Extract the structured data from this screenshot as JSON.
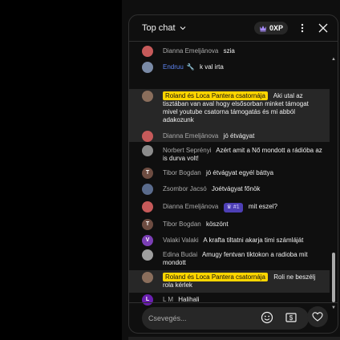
{
  "header": {
    "title": "Top chat",
    "xp": "0XP",
    "icons": {
      "dropdown": "chevron-down-icon",
      "crown": "crown-icon",
      "more": "more-vert-icon",
      "close": "close-icon"
    }
  },
  "colors": {
    "background": "#0f0f0f",
    "highlight": "#272727",
    "owner_badge": "#ffd600",
    "moderator": "#5e84f1",
    "member_badge": "#4d3fb5"
  },
  "messages": [
    {
      "author": "Dianna Emeljānova",
      "text": "szia",
      "avatar_color": "#c65a5a"
    },
    {
      "author": "Endruu",
      "text": "k val irta",
      "role": "moderator",
      "avatar_color": "#7a8aa6"
    },
    {
      "author": "Roland és Loca Pantera csatornája",
      "text": "Aki utal az tisztában van aval hogy elsősorban minket támogat mivel youtube csatorna támogatás és mi abból adakozunk",
      "role": "owner",
      "avatar_color": "#8a6e5c"
    },
    {
      "author": "Dianna Emeljānova",
      "text": "jó étvágyat",
      "avatar_color": "#c65a5a"
    },
    {
      "author": "Norbert Seprényi",
      "text": "Azért amit a Nő mondott a rádióba az is durva volt!",
      "avatar_color": "#8c8c8c"
    },
    {
      "author": "Tibor Bogdan",
      "text": "jó étvágyat egyél báttya",
      "avatar_initial": "T",
      "avatar_color": "#6d4c41"
    },
    {
      "author": "Zsombor Jacsó",
      "text": "Joétvágyat főnök",
      "avatar_color": "#5a6b8c"
    },
    {
      "author": "Dianna Emeljānova",
      "text": "mit eszel?",
      "member_badge": "#1",
      "avatar_color": "#c65a5a"
    },
    {
      "author": "Tibor Bogdan",
      "text": "köszönt",
      "avatar_initial": "T",
      "avatar_color": "#6d4c41"
    },
    {
      "author": "Valaki Valaki",
      "text": "A krafta tiltatni akarja timi számláját",
      "avatar_initial": "V",
      "avatar_color": "#7b3fb5"
    },
    {
      "author": "Edina Budai",
      "text": "Amugy fentvan tiktokon a radioba mit mondott",
      "avatar_color": "#9e9e9e"
    },
    {
      "author": "Roland és Loca Pantera csatornája",
      "text": "Roli ne beszélj rola kérlek",
      "role": "owner",
      "avatar_color": "#8a6e5c"
    },
    {
      "author": "L M",
      "text": "Halihali",
      "avatar_initial": "L",
      "avatar_color": "#6a1fb0"
    }
  ],
  "footer": {
    "placeholder": "Csevegés...",
    "icons": {
      "emoji": "emoji-icon",
      "super_chat": "money-icon",
      "like": "heart-icon"
    }
  }
}
